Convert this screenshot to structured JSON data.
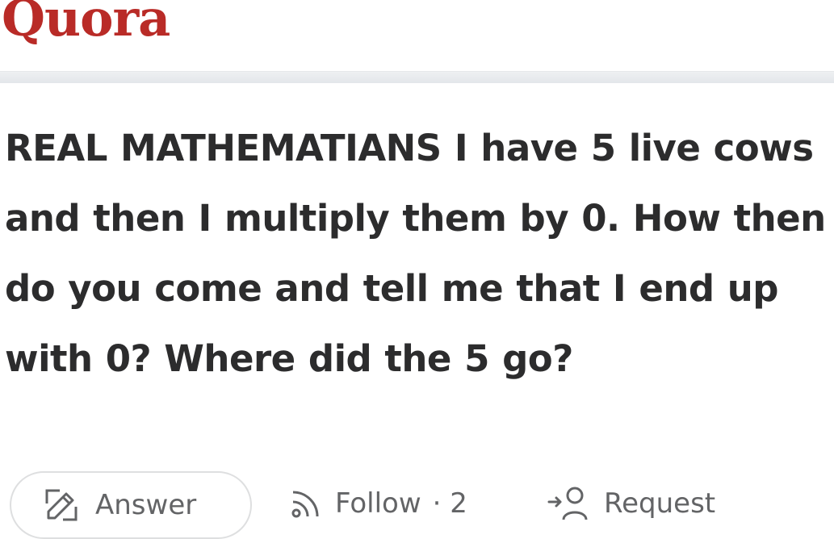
{
  "header": {
    "logo": "Quora"
  },
  "question": {
    "text": "REAL MATHEMATIANS I have 5 live cows and then I multiply them by 0. How then do you come and tell me that I end up with 0? Where did the 5 go?"
  },
  "actions": {
    "answer_label": "Answer",
    "follow_label": "Follow",
    "follow_count": "· 2",
    "request_label": "Request",
    "icons": {
      "answer": "pencil-edit-icon",
      "follow": "wifi-follow-icon",
      "request": "person-add-icon"
    }
  },
  "colors": {
    "brand": "#b92b27",
    "text": "#282829",
    "muted": "#636466",
    "divider": "#e6e8ea"
  }
}
